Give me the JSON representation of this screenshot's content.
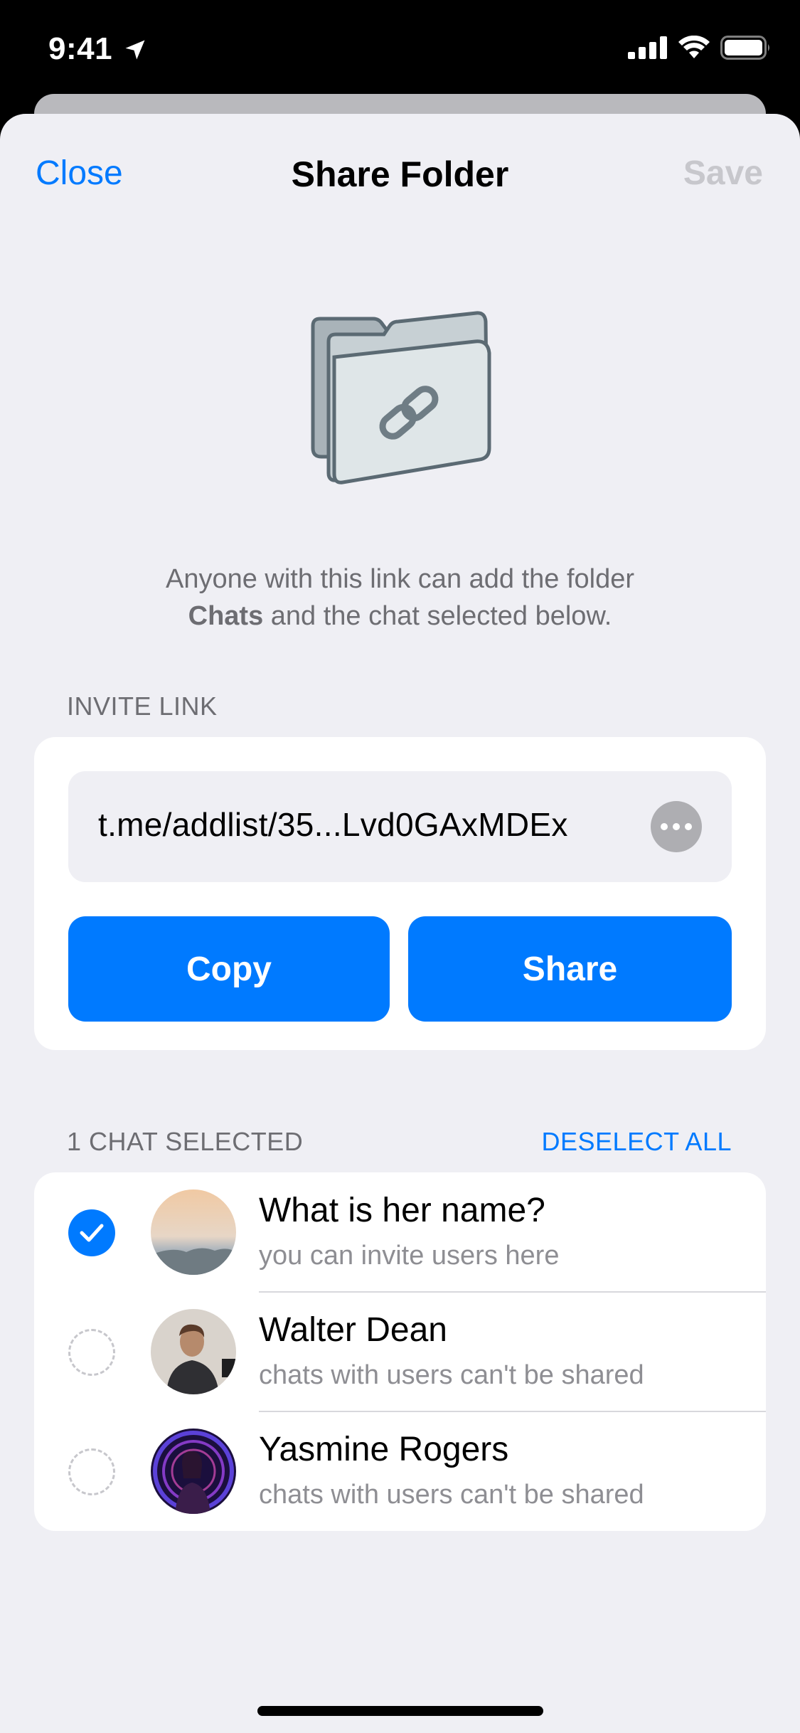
{
  "status_bar": {
    "time": "9:41"
  },
  "nav": {
    "close": "Close",
    "title": "Share Folder",
    "save": "Save"
  },
  "description": {
    "line1": "Anyone with this link can add the folder",
    "bold": "Chats",
    "line2_rest": " and the chat selected below."
  },
  "invite": {
    "section_label": "INVITE LINK",
    "link": "t.me/addlist/35...Lvd0GAxMDEx",
    "copy": "Copy",
    "share": "Share"
  },
  "chats": {
    "section_label": "1 CHAT SELECTED",
    "deselect_all": "DESELECT ALL",
    "items": [
      {
        "title": "What is her name?",
        "subtitle": "you can invite users here",
        "selected": true
      },
      {
        "title": "Walter Dean",
        "subtitle": "chats with users can't be shared",
        "selected": false
      },
      {
        "title": "Yasmine Rogers",
        "subtitle": "chats with users can't be shared",
        "selected": false
      }
    ]
  },
  "colors": {
    "accent": "#007aff",
    "background": "#efeff4",
    "disabled": "#c7c7cc",
    "secondary_text": "#8e8e93"
  }
}
